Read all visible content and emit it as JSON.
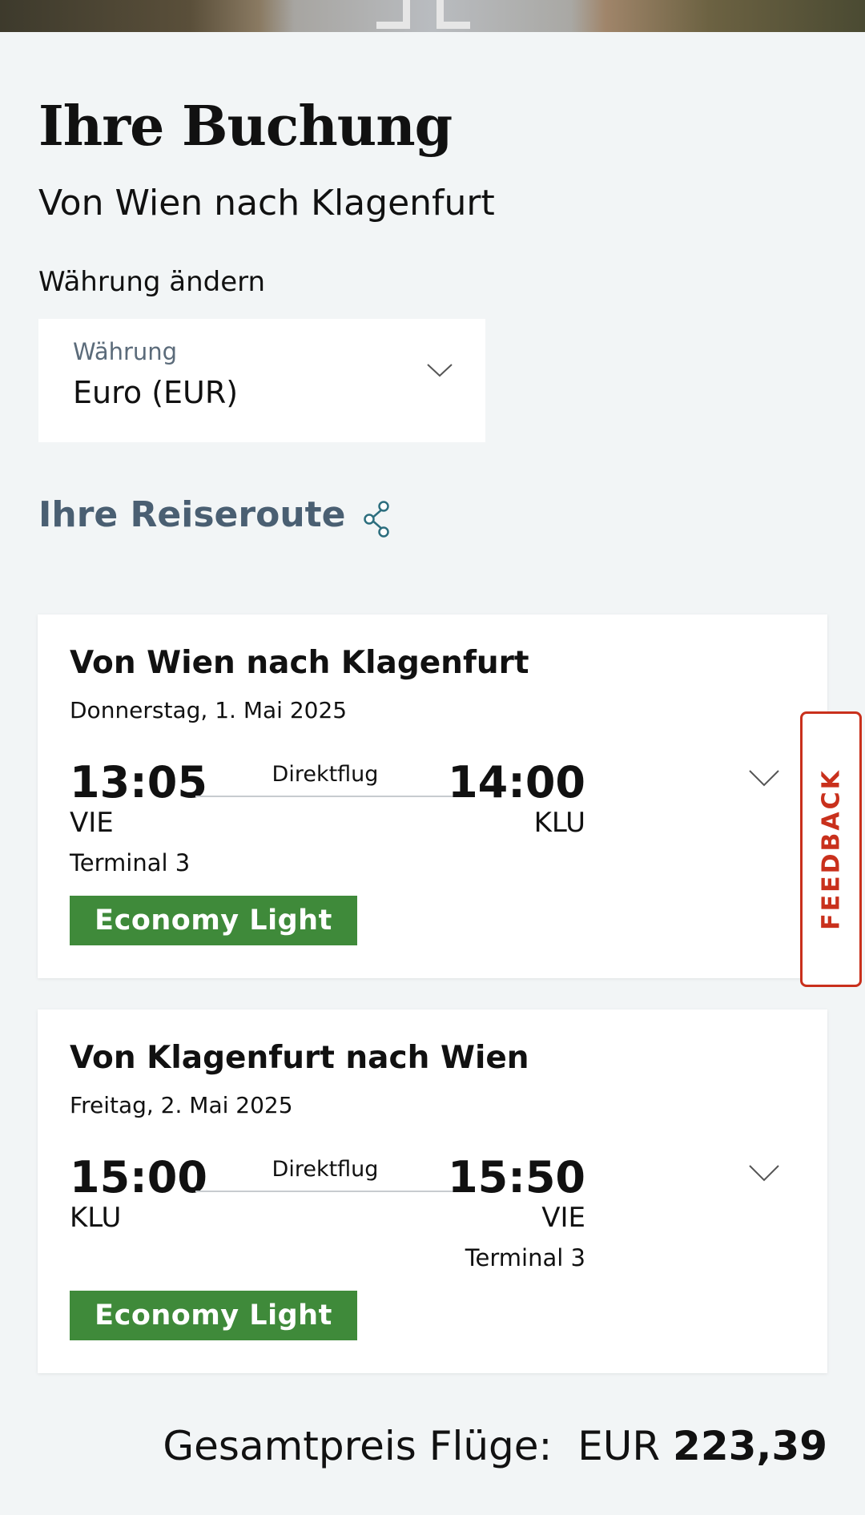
{
  "header": {
    "title": "Ihre Buchung",
    "subtitle": "Von Wien nach Klagenfurt"
  },
  "currency": {
    "section_label": "Währung ändern",
    "select_label": "Währung",
    "select_value": "Euro (EUR)",
    "chevron_icon": "chevron-down-icon"
  },
  "itinerary": {
    "heading": "Ihre Reiseroute",
    "share_icon": "share-icon",
    "flights": [
      {
        "title": "Von Wien nach Klagenfurt",
        "date": "Donnerstag, 1. Mai 2025",
        "departure_time": "13:05",
        "departure_code": "VIE",
        "departure_terminal": "Terminal 3",
        "arrival_time": "14:00",
        "arrival_code": "KLU",
        "arrival_terminal": "",
        "connection": "Direktflug",
        "fare": "Economy Light"
      },
      {
        "title": "Von Klagenfurt nach Wien",
        "date": "Freitag, 2. Mai 2025",
        "departure_time": "15:00",
        "departure_code": "KLU",
        "departure_terminal": "",
        "arrival_time": "15:50",
        "arrival_code": "VIE",
        "arrival_terminal": "Terminal 3",
        "connection": "Direktflug",
        "fare": "Economy Light"
      }
    ]
  },
  "feedback": {
    "label": "FEEDBACK"
  },
  "total": {
    "label": "Gesamtpreis Flüge:",
    "currency": "EUR",
    "amount": "223,39"
  },
  "colors": {
    "background": "#f2f5f6",
    "fare_badge": "#3f8a3a",
    "feedback": "#c9301c",
    "route_heading": "#4a5f72"
  }
}
